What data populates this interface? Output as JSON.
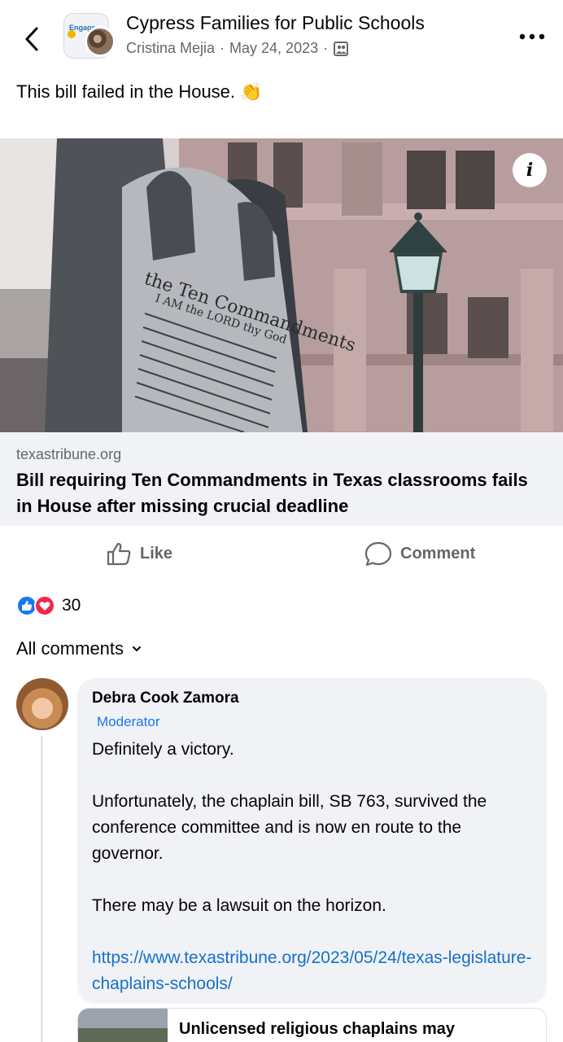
{
  "header": {
    "group_name": "Cypress Families for Public Schools",
    "author": "Cristina Mejia",
    "date": "May 24, 2023",
    "separator": "·",
    "group_badge_text": "Engage"
  },
  "post": {
    "text": "This bill failed in the House. 👏"
  },
  "link_preview": {
    "domain": "texastribune.org",
    "title": "Bill requiring Ten Commandments in Texas classrooms fails in House after missing crucial deadline",
    "info_label": "i",
    "monument_lines": [
      "the Ten Commandments",
      "I AM the LORD thy God"
    ]
  },
  "actions": {
    "like_label": "Like",
    "comment_label": "Comment"
  },
  "reactions": {
    "count": "30"
  },
  "comments_sort": {
    "label": "All comments"
  },
  "comment": {
    "author": "Debra Cook Zamora",
    "badge": "Moderator",
    "paragraph_1": "Definitely a victory.",
    "paragraph_2": "Unfortunately, the chaplain bill, SB 763, survived the conference committee and is now en route to the governor.",
    "paragraph_3": "There may be a lawsuit on the horizon.",
    "link": "https://www.texastribune.org/2023/05/24/texas-legislature-chaplains-schools/"
  },
  "next_preview": {
    "title": "Unlicensed religious chaplains may"
  },
  "colors": {
    "link_blue": "#1670c8",
    "secondary_text": "#65676b",
    "like_blue": "#1877f2",
    "love_red": "#f02849"
  }
}
